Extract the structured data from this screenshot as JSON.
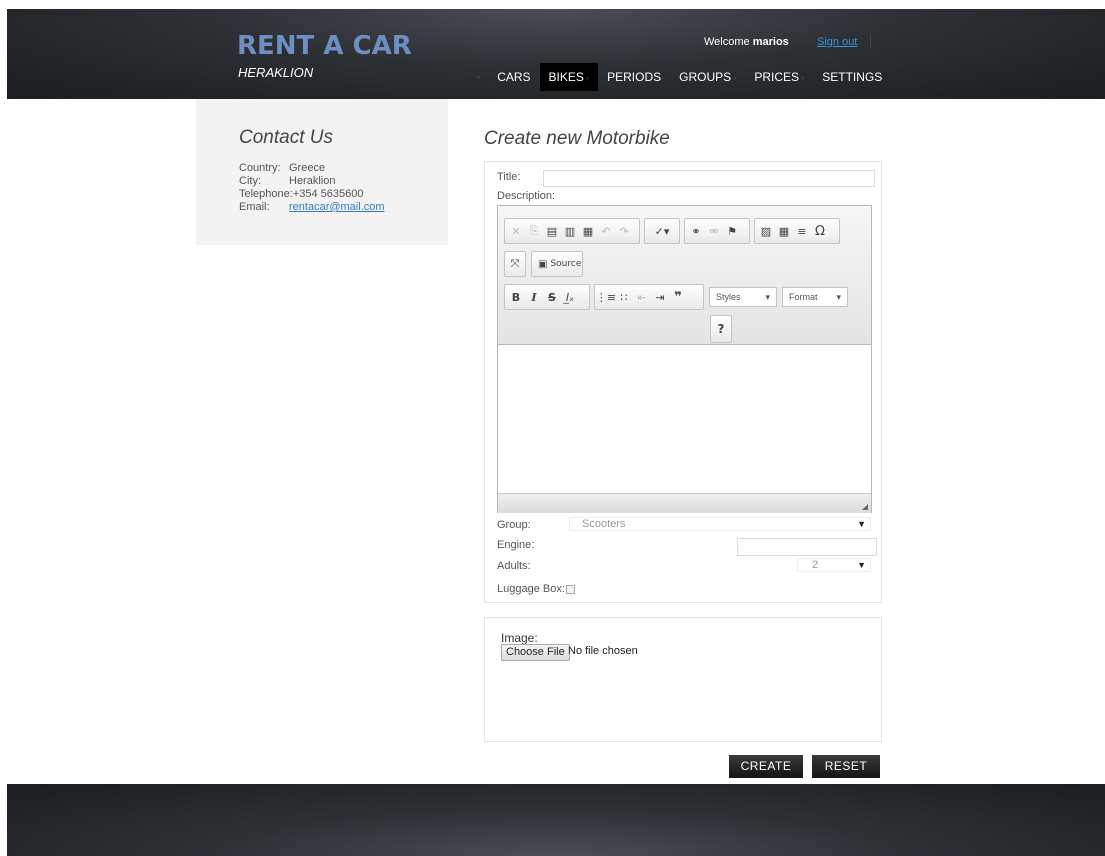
{
  "header": {
    "logo_title": "RENT A CAR",
    "logo_subtitle": "HERAKLION",
    "welcome_prefix": "Welcome ",
    "username": "marios",
    "signout_label": "Sign out"
  },
  "nav": {
    "items": [
      {
        "label": "CARS",
        "active": false,
        "has_submenu": false
      },
      {
        "label": "BIKES",
        "active": true,
        "has_submenu": true
      },
      {
        "label": "PERIODS",
        "active": false,
        "has_submenu": false
      },
      {
        "label": "GROUPS",
        "active": false,
        "has_submenu": true
      },
      {
        "label": "PRICES",
        "active": false,
        "has_submenu": true
      },
      {
        "label": "SETTINGS",
        "active": false,
        "has_submenu": false
      }
    ]
  },
  "sidebar": {
    "title": "Contact Us",
    "country_label": "Country:",
    "country_value": "Greece",
    "city_label": "City:",
    "city_value": "Heraklion",
    "telephone_label": "Telephone:",
    "telephone_value": "+354 5635600",
    "email_label": "Email:",
    "email_value": "rentacar@mail.com"
  },
  "form": {
    "heading": "Create new Motorbike",
    "title_label": "Title:",
    "title_value": "",
    "description_label": "Description:",
    "editor": {
      "source_label": "Source",
      "styles_label": "Styles",
      "format_label": "Format",
      "help_label": "?"
    },
    "group_label": "Group:",
    "group_value": "Scooters",
    "engine_label": "Engine:",
    "engine_value": "",
    "adults_label": "Adults:",
    "adults_value": "2",
    "luggage_label": "Luggage Box:",
    "luggage_checked": false
  },
  "image": {
    "label": "Image:",
    "choose_label": "Choose File",
    "file_status": "No file chosen"
  },
  "buttons": {
    "create_label": "CREATE",
    "reset_label": "RESET"
  }
}
